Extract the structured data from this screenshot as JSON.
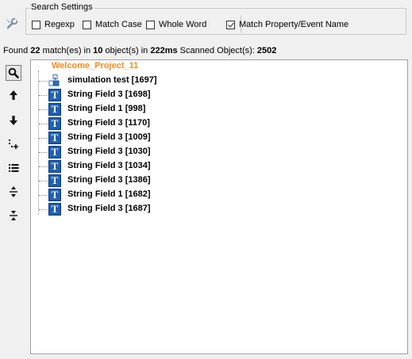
{
  "settings": {
    "legend": "Search Settings",
    "options": [
      {
        "label": "Regexp",
        "checked": false
      },
      {
        "label": "Match Case",
        "checked": false
      },
      {
        "label": "Whole Word",
        "checked": false
      },
      {
        "label": "Match Property/Event Name",
        "checked": true
      }
    ]
  },
  "status": {
    "found_prefix": "Found",
    "match_count": "22",
    "match_suffix": "match(es) in",
    "object_count": "10",
    "object_suffix": "object(s) in",
    "time": "222ms",
    "scanned_label": "Scanned Object(s):",
    "scanned_count": "2502"
  },
  "toolbar": {
    "icons": [
      "search-icon",
      "arrow-up-icon",
      "arrow-down-icon",
      "add-node-icon",
      "list-icon",
      "expand-icon",
      "collapse-icon"
    ]
  },
  "tree": {
    "root": "Welcome_Project_11",
    "items": [
      {
        "label": "simulation test [1697]",
        "icon": "simulation-icon"
      },
      {
        "label": "String Field 3 [1698]",
        "icon": "text-field-icon"
      },
      {
        "label": "String Field 1 [998]",
        "icon": "text-field-icon"
      },
      {
        "label": "String Field 3 [1170]",
        "icon": "text-field-icon"
      },
      {
        "label": "String Field 3 [1009]",
        "icon": "text-field-icon"
      },
      {
        "label": "String Field 3 [1030]",
        "icon": "text-field-icon"
      },
      {
        "label": "String Field 3 [1034]",
        "icon": "text-field-icon"
      },
      {
        "label": "String Field 3 [1386]",
        "icon": "text-field-icon"
      },
      {
        "label": "String Field 1 [1682]",
        "icon": "text-field-icon"
      },
      {
        "label": "String Field 3 [1687]",
        "icon": "text-field-icon"
      }
    ]
  }
}
